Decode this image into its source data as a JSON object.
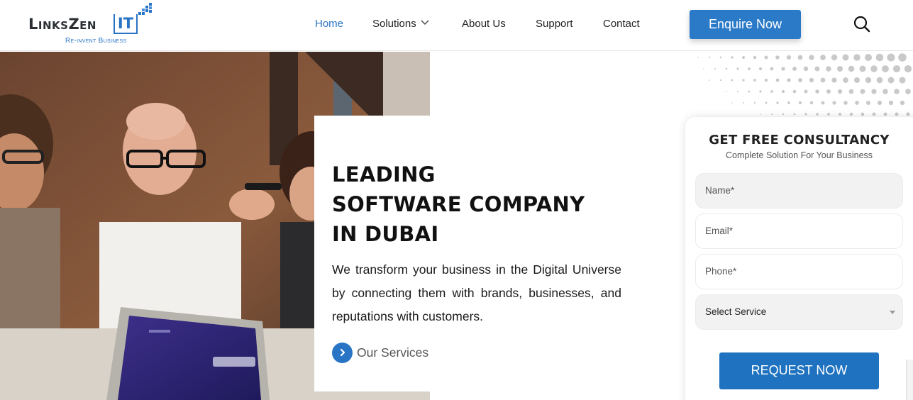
{
  "brand": {
    "logo_text": "LinksZen",
    "logo_suffix": "IT",
    "tagline": "Re-invent Business",
    "accent_color": "#2a74c6"
  },
  "nav": {
    "items": [
      {
        "label": "Home",
        "active": true
      },
      {
        "label": "Solutions",
        "has_dropdown": true
      },
      {
        "label": "About Us"
      },
      {
        "label": "Support"
      },
      {
        "label": "Contact"
      }
    ],
    "cta_label": "Enquire Now",
    "search_icon": "search-icon"
  },
  "hero": {
    "title_lines": [
      "LEADING",
      "SOFTWARE COMPANY",
      "IN DUBAI"
    ],
    "description": "We transform your business in the Digital Universe by connecting them with brands, businesses, and reputations with customers.",
    "services_link": "Our Services",
    "services_icon": "chevron-right-icon"
  },
  "form": {
    "title": "GET FREE CONSULTANCY",
    "subtitle": "Complete Solution For Your Business",
    "name_placeholder": "Name*",
    "email_placeholder": "Email*",
    "phone_placeholder": "Phone*",
    "service_selected": "Select Service",
    "submit_label": "REQUEST NOW"
  }
}
